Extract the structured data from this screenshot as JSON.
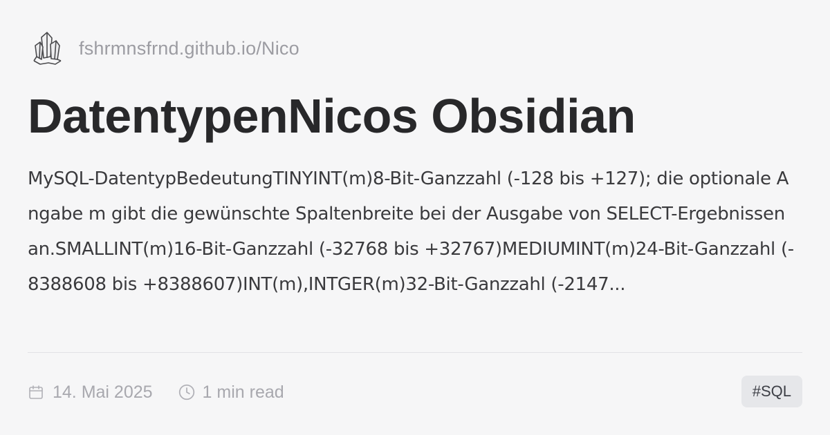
{
  "site": {
    "logo_icon": "crystal-logo-icon",
    "url": "fshrmnsfrnd.github.io/Nico"
  },
  "post": {
    "title": "DatentypenNicos Obsidian",
    "description": "MySQL-DatentypBedeutungTINYINT(m)8-Bit-Ganzzahl (-128 bis +127); die optionale Angabe m gibt die gewünschte Spaltenbreite bei der Ausgabe von SELECT-Ergebnissen an.SMALLINT(m)16-Bit-Ganzzahl (-32768 bis +32767)MEDIUMINT(m)24-Bit-Ganzzahl (-8388608 bis +8388607)INT(m),INTGER(m)32-Bit-Ganzzahl (-2147..."
  },
  "meta": {
    "date_icon": "calendar-icon",
    "date": "14. Mai 2025",
    "read_icon": "clock-icon",
    "read_time": "1 min read"
  },
  "tags": [
    {
      "label": "#SQL"
    }
  ],
  "colors": {
    "background": "#f6f6f7",
    "title": "#28282a",
    "muted": "#9c9ca2",
    "tag_bg": "#e6e7ea"
  }
}
